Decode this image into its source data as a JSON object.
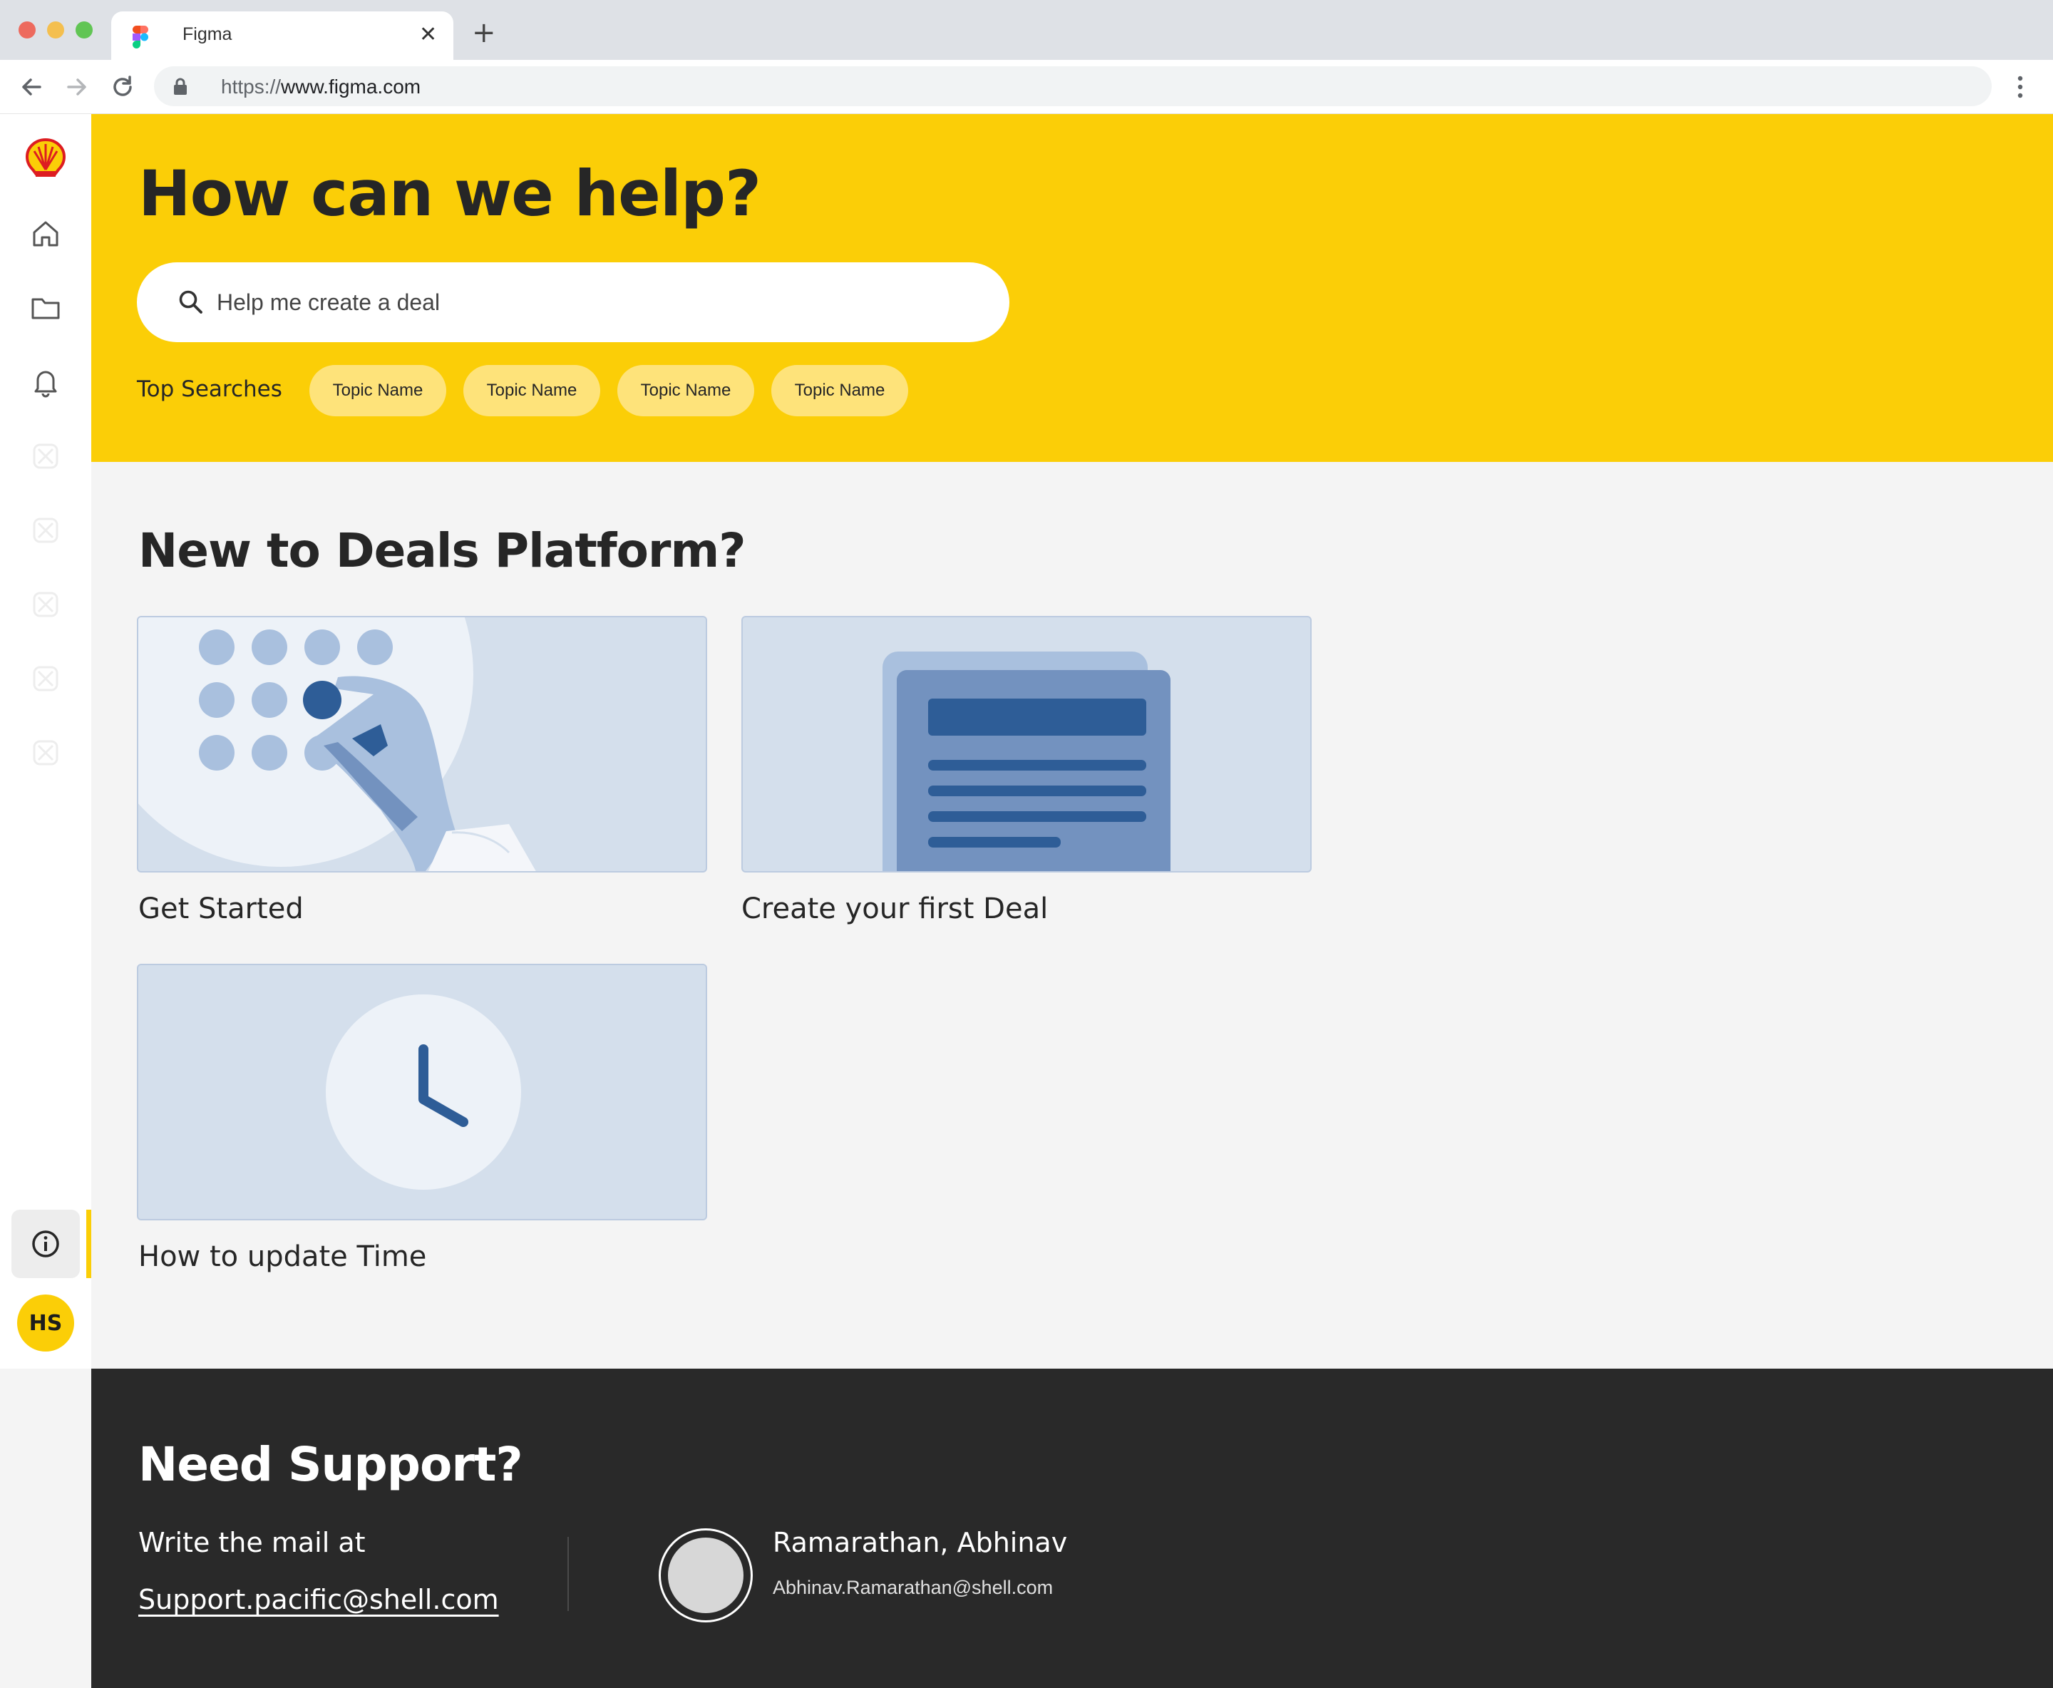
{
  "browser": {
    "tab_title": "Figma",
    "url_scheme": "https://",
    "url_host": "www.figma.com",
    "traffic_light_colors": [
      "#ed6a5e",
      "#f4bf4f",
      "#61c554"
    ]
  },
  "sidebar": {
    "items": [
      {
        "name": "home",
        "icon": "home-icon"
      },
      {
        "name": "files",
        "icon": "folder-icon"
      },
      {
        "name": "notifications",
        "icon": "bell-icon"
      },
      {
        "name": "placeholder-1",
        "icon": "placeholder-icon"
      },
      {
        "name": "placeholder-2",
        "icon": "placeholder-icon"
      },
      {
        "name": "placeholder-3",
        "icon": "placeholder-icon"
      },
      {
        "name": "placeholder-4",
        "icon": "placeholder-icon"
      },
      {
        "name": "placeholder-5",
        "icon": "placeholder-icon"
      }
    ],
    "help_icon": "info-icon",
    "user_initials": "HS"
  },
  "hero": {
    "title": "How can we help?",
    "search_placeholder": "Help me create a deal",
    "top_searches_label": "Top Searches",
    "topics": [
      "Topic Name",
      "Topic Name",
      "Topic Name",
      "Topic Name"
    ]
  },
  "main": {
    "title": "New to Deals Platform?",
    "cards": [
      {
        "label": "Get Started",
        "illustration": "keypad-hand"
      },
      {
        "label": "Create your first Deal",
        "illustration": "document"
      },
      {
        "label": "How to update Time",
        "illustration": "clock"
      }
    ]
  },
  "footer": {
    "title": "Need Support?",
    "write_text": "Write the mail at",
    "support_email": "Support.pacific@shell.com",
    "contact_name": "Ramarathan, Abhinav",
    "contact_email": "Abhinav.Ramarathan@shell.com"
  },
  "colors": {
    "brand_yellow": "#fbce07",
    "chip_yellow": "#fee37a",
    "footer_bg": "#292929",
    "page_bg": "#f4f4f4",
    "illustration_bg": "#d4dfec",
    "illustration_dark_blue": "#2e5d97"
  }
}
